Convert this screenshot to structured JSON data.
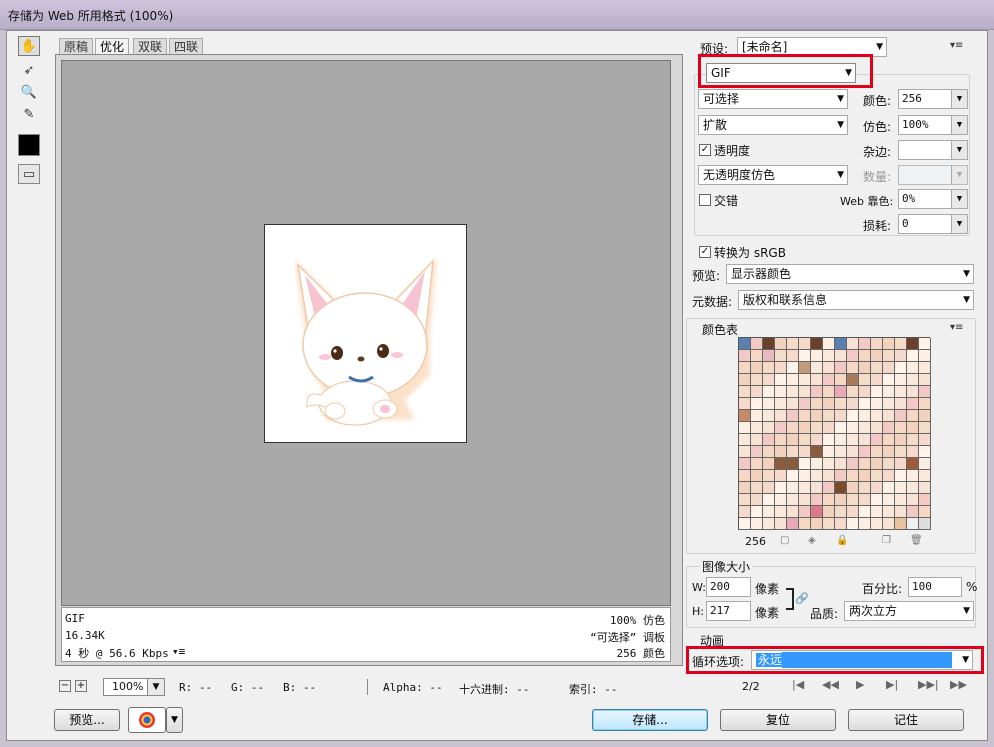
{
  "window": {
    "title": "存储为 Web 所用格式 (100%)"
  },
  "tabs": [
    "原稿",
    "优化",
    "双联",
    "四联"
  ],
  "selected_tab": 1,
  "info": {
    "format": "GIF",
    "size": "16.34K",
    "time": "4 秒 @ 56.6 Kbps",
    "dither": "100% 仿色",
    "palette": "“可选择” 调板",
    "colors": "256 颜色"
  },
  "status": {
    "zoom": "100%",
    "r": "R: --",
    "g": "G: --",
    "b": "B: --",
    "alpha": "Alpha: --",
    "hex": "十六进制: --",
    "index": "索引: --"
  },
  "buttons": {
    "preview": "预览...",
    "save": "存储...",
    "reset": "复位",
    "remember": "记住"
  },
  "settings": {
    "preset_label": "预设:",
    "preset_value": "[未命名]",
    "format_value": "GIF",
    "reduction_value": "可选择",
    "colors_label": "颜色:",
    "colors_value": "256",
    "dither_algo_value": "扩散",
    "dither_label": "仿色:",
    "dither_value": "100%",
    "transparency_label": "透明度",
    "matte_label": "杂边:",
    "transparency_dither_value": "无透明度仿色",
    "amount_label": "数量:",
    "interlace_label": "交错",
    "websnap_label": "Web 靠色:",
    "websnap_value": "0%",
    "lossy_label": "损耗:",
    "lossy_value": "0",
    "srgb_label": "转换为 sRGB",
    "preview_label": "预览:",
    "preview_value": "显示器颜色",
    "metadata_label": "元数据:",
    "metadata_value": "版权和联系信息"
  },
  "color_table": {
    "title": "颜色表",
    "count": "256"
  },
  "image_size": {
    "title": "图像大小",
    "w_label": "W:",
    "w_value": "200",
    "h_label": "H:",
    "h_value": "217",
    "unit": "像素",
    "percent_label": "百分比:",
    "percent_value": "100",
    "percent_unit": "%",
    "quality_label": "品质:",
    "quality_value": "两次立方"
  },
  "animation": {
    "title": "动画",
    "loop_label": "循环选项:",
    "loop_value": "永远",
    "frame_counter": "2/2"
  },
  "colors": {
    "highlight_red": "#e0001a",
    "canvas_gray": "#a9a9a9",
    "select_blue": "#3399ff"
  }
}
